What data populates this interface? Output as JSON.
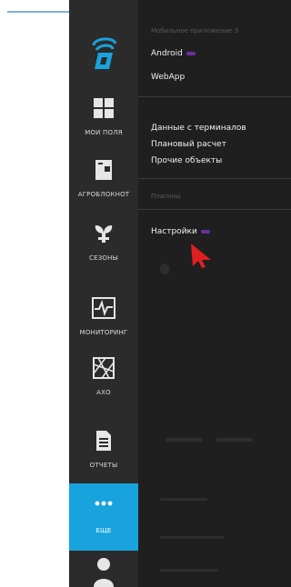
{
  "sidebar": {
    "items": [
      {
        "label": "МОИ ПОЛЯ",
        "icon": "grid-icon"
      },
      {
        "label": "АГРОБЛОКНОТ",
        "icon": "notebook-icon"
      },
      {
        "label": "СЕЗОНЫ",
        "icon": "plant-icon"
      },
      {
        "label": "МОНИТОРИНГ",
        "icon": "pulse-icon"
      },
      {
        "label": "АХО",
        "icon": "map-icon"
      },
      {
        "label": "ОТЧЕТЫ",
        "icon": "document-icon"
      },
      {
        "label": "ЕЩЕ",
        "icon": "more-icon"
      }
    ],
    "active_index": 6
  },
  "menu": {
    "section_mobile": "Мобильное приложение 3",
    "android": "Android",
    "webapp": "WebApp",
    "data_terminals": "Данные с терминалов",
    "planned_calc": "Плановый расчет",
    "other_objects": "Прочие объекты",
    "plugins": "Плагины",
    "settings": "Настройки"
  },
  "colors": {
    "sidebar_bg": "#2b2b2b",
    "panel_bg": "#1f1f1f",
    "active_accent": "#19a3dd",
    "badge": "#6a2fa0",
    "cursor": "#e02020"
  }
}
